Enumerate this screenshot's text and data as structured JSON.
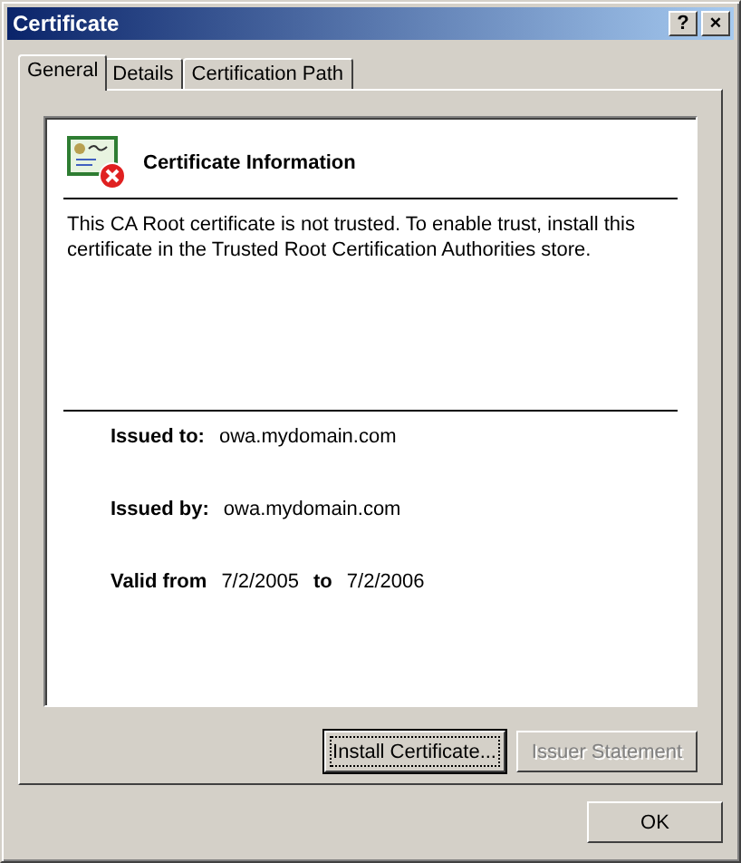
{
  "window": {
    "title": "Certificate",
    "title_buttons": [
      "?",
      "×"
    ]
  },
  "tabs": [
    {
      "label": "General",
      "selected": true
    },
    {
      "label": "Details",
      "selected": false
    },
    {
      "label": "Certification Path",
      "selected": false
    }
  ],
  "info": {
    "heading": "Certificate Information",
    "message": "This CA Root certificate is not trusted. To enable trust, install this certificate in the Trusted Root Certification Authorities store.",
    "issued_to_label": "Issued to:",
    "issued_to": "owa.mydomain.com",
    "issued_by_label": "Issued by:",
    "issued_by": "owa.mydomain.com",
    "valid_from_label": "Valid from",
    "valid_from": "7/2/2005",
    "valid_to_label": "to",
    "valid_to": "7/2/2006"
  },
  "panel_buttons": [
    {
      "label": "Install Certificate...",
      "disabled": false,
      "focused": true
    },
    {
      "label": "Issuer Statement",
      "disabled": true,
      "focused": false
    }
  ],
  "ok_button": {
    "label": "OK"
  }
}
